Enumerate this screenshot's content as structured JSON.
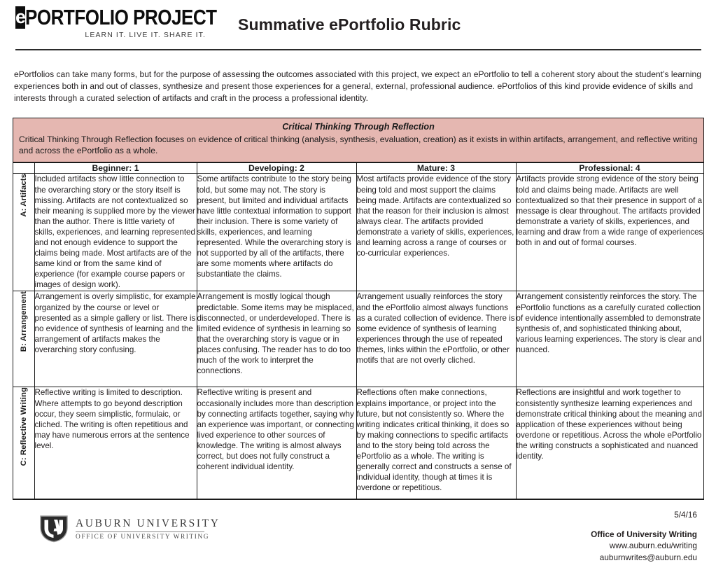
{
  "header": {
    "logo_e": "e",
    "logo_words": "PORTFOLIO PROJECT",
    "logo_tagline": "LEARN IT. LIVE IT. SHARE IT.",
    "doc_title": "Summative ePortfolio Rubric"
  },
  "intro": "ePortfolios can take many forms, but for the purpose of assessing the outcomes associated with this project, we expect an ePortfolio to tell a coherent story about the student’s learning experiences both in and out of classes, synthesize and present those experiences for a general, external, professional audience. ePortfolios of this kind provide evidence of skills and interests through a curated selection of artifacts and craft in the process a professional identity.",
  "band": {
    "title": "Critical Thinking Through Reflection",
    "description": "Critical Thinking Through Reflection focuses on evidence of critical thinking (analysis, synthesis, evaluation, creation) as it exists in within artifacts, arrangement, and reflective writing and across the ePortfolio as a whole.",
    "background_color": "#e5b7b1"
  },
  "table": {
    "column_headers": [
      "Beginner: 1",
      "Developing: 2",
      "Mature: 3",
      "Professional: 4"
    ],
    "rows": [
      {
        "label": "A: Artifacts",
        "cells": [
          "Included artifacts show little connection to the overarching story or the story itself is missing. Artifacts are not contextualized so their meaning is supplied more by the viewer than the author. There is little variety of skills, experiences, and learning represented and not enough evidence to support the claims being made. Most artifacts are of the same kind or from the same kind of experience (for example course papers or images of design work).",
          "Some artifacts contribute to the story being told, but some may not. The story is present, but limited and individual artifacts have little contextual information to support their inclusion. There is some variety of skills, experiences, and learning represented. While the overarching story is not supported by all of the artifacts, there are some moments where artifacts do substantiate the claims.",
          "Most artifacts provide evidence of the story being told and most support the claims being made. Artifacts are contextualized so that the reason for their inclusion is almost always clear. The artifacts provided demonstrate a variety of skills, experiences, and learning across a range of courses or co-curricular experiences.",
          "Artifacts provide strong evidence of the story being told and claims being made. Artifacts are well contextualized so that their presence in support of a message is clear throughout. The artifacts provided demonstrate a variety of skills, experiences, and learning and draw from a wide range of experiences both in and out of formal courses."
        ]
      },
      {
        "label": "B: Arrangement",
        "cells": [
          "Arrangement is overly simplistic, for example organized by the course or level or presented as a simple gallery or list. There is no evidence of synthesis of learning and the arrangement of artifacts makes the overarching story confusing.",
          "Arrangement is mostly logical though predictable. Some items may be misplaced, disconnected, or underdeveloped. There is limited evidence of synthesis in learning so that the overarching story is vague or in places confusing. The reader has to do too much of the work to interpret the connections.",
          "Arrangement usually reinforces the story and the ePortfolio almost always functions as a curated collection of evidence. There is some evidence of synthesis of learning experiences through the use of repeated themes, links within the  ePortfolio, or other motifs that are not overly cliched.",
          "Arrangement consistently reinforces the story. The ePortfolio functions as a carefully curated collection of evidence intentionally assembled to demonstrate synthesis of, and sophisticated thinking about, various learning experiences.  The story is clear and nuanced."
        ]
      },
      {
        "label": "C: Reflective Writing",
        "cells": [
          "Reflective writing is limited to description. Where attempts to go beyond description occur, they seem simplistic, formulaic, or cliched. The writing is often repetitious and may have numerous errors at the sentence level.",
          "Reflective writing is present and occasionally includes more than description by connecting artifacts together, saying why an experience was important, or connecting lived experience to other sources of knowledge. The writing is almost always correct, but does not fully construct a coherent individual identity.",
          "Reflections often make connections, explains importance, or project into the future, but not consistently so. Where the writing indicates critical thinking, it does so by making connections to specific artifacts and to the story being told across the ePortfolio as a whole. The writing is generally correct and constructs a sense of individual identity, though at times it is overdone or repetitious.",
          "Reflections are insightful and work together to consistently synthesize learning experiences and demonstrate critical thinking about the meaning and application of these experiences without being overdone or repetitious. Across the whole ePortfolio the writing constructs a sophisticated and nuanced identity."
        ]
      }
    ]
  },
  "footer": {
    "university": "AUBURN UNIVERSITY",
    "office_line": "OFFICE OF UNIVERSITY WRITING",
    "date": "5/4/16",
    "office_name": "Office of University Writing",
    "website": "www.auburn.edu/writing",
    "email": "auburnwrites@auburn.edu"
  }
}
